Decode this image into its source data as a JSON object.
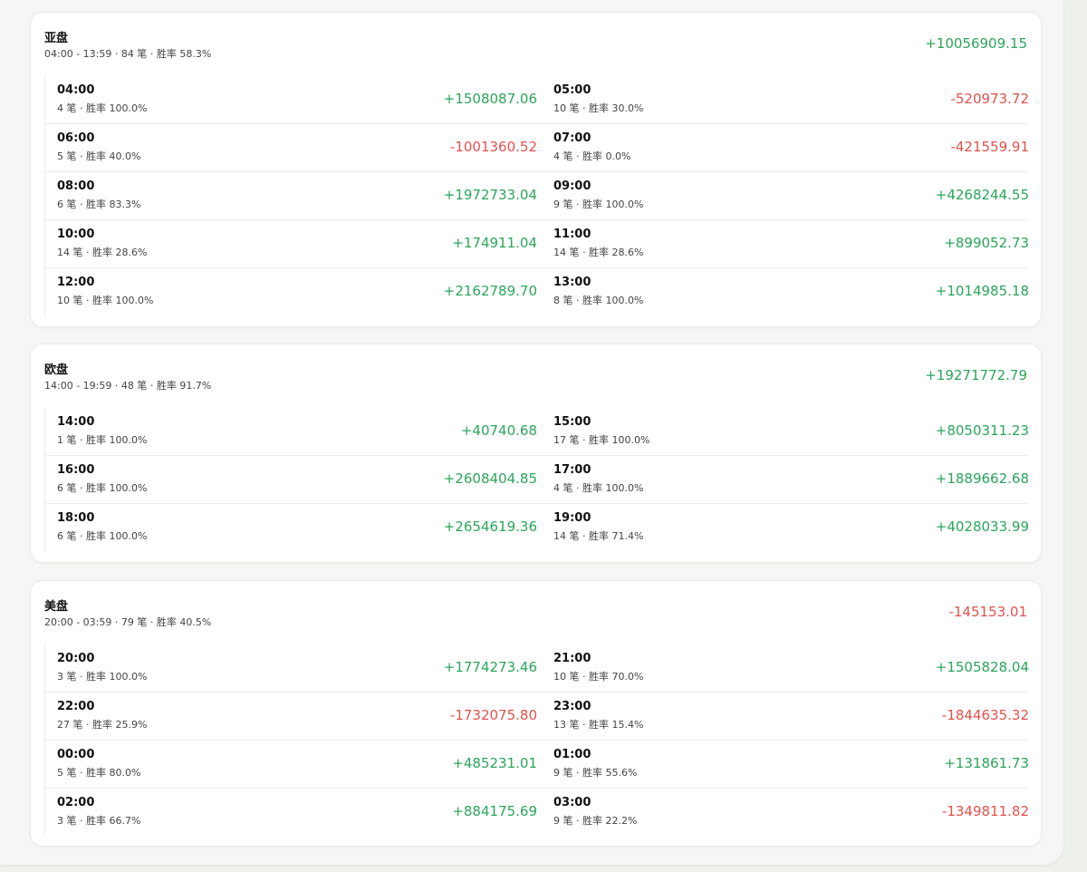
{
  "sessions": [
    {
      "name": "亚盘",
      "summary": "04:00 - 13:59 · 84 笔 · 胜率 58.3%",
      "total": "+10056909.15",
      "total_sign": "pos",
      "hours": [
        {
          "hour": "04:00",
          "stats": "4 笔 · 胜率 100.0%",
          "pnl": "+1508087.06",
          "sign": "pos"
        },
        {
          "hour": "05:00",
          "stats": "10 笔 · 胜率 30.0%",
          "pnl": "-520973.72",
          "sign": "neg"
        },
        {
          "hour": "06:00",
          "stats": "5 笔 · 胜率 40.0%",
          "pnl": "-1001360.52",
          "sign": "neg"
        },
        {
          "hour": "07:00",
          "stats": "4 笔 · 胜率 0.0%",
          "pnl": "-421559.91",
          "sign": "neg"
        },
        {
          "hour": "08:00",
          "stats": "6 笔 · 胜率 83.3%",
          "pnl": "+1972733.04",
          "sign": "pos"
        },
        {
          "hour": "09:00",
          "stats": "9 笔 · 胜率 100.0%",
          "pnl": "+4268244.55",
          "sign": "pos"
        },
        {
          "hour": "10:00",
          "stats": "14 笔 · 胜率 28.6%",
          "pnl": "+174911.04",
          "sign": "pos"
        },
        {
          "hour": "11:00",
          "stats": "14 笔 · 胜率 28.6%",
          "pnl": "+899052.73",
          "sign": "pos"
        },
        {
          "hour": "12:00",
          "stats": "10 笔 · 胜率 100.0%",
          "pnl": "+2162789.70",
          "sign": "pos"
        },
        {
          "hour": "13:00",
          "stats": "8 笔 · 胜率 100.0%",
          "pnl": "+1014985.18",
          "sign": "pos"
        }
      ]
    },
    {
      "name": "欧盘",
      "summary": "14:00 - 19:59 · 48 笔 · 胜率 91.7%",
      "total": "+19271772.79",
      "total_sign": "pos",
      "hours": [
        {
          "hour": "14:00",
          "stats": "1 笔 · 胜率 100.0%",
          "pnl": "+40740.68",
          "sign": "pos"
        },
        {
          "hour": "15:00",
          "stats": "17 笔 · 胜率 100.0%",
          "pnl": "+8050311.23",
          "sign": "pos"
        },
        {
          "hour": "16:00",
          "stats": "6 笔 · 胜率 100.0%",
          "pnl": "+2608404.85",
          "sign": "pos"
        },
        {
          "hour": "17:00",
          "stats": "4 笔 · 胜率 100.0%",
          "pnl": "+1889662.68",
          "sign": "pos"
        },
        {
          "hour": "18:00",
          "stats": "6 笔 · 胜率 100.0%",
          "pnl": "+2654619.36",
          "sign": "pos"
        },
        {
          "hour": "19:00",
          "stats": "14 笔 · 胜率 71.4%",
          "pnl": "+4028033.99",
          "sign": "pos"
        }
      ]
    },
    {
      "name": "美盘",
      "summary": "20:00 - 03:59 · 79 笔 · 胜率 40.5%",
      "total": "-145153.01",
      "total_sign": "neg",
      "hours": [
        {
          "hour": "20:00",
          "stats": "3 笔 · 胜率 100.0%",
          "pnl": "+1774273.46",
          "sign": "pos"
        },
        {
          "hour": "21:00",
          "stats": "10 笔 · 胜率 70.0%",
          "pnl": "+1505828.04",
          "sign": "pos"
        },
        {
          "hour": "22:00",
          "stats": "27 笔 · 胜率 25.9%",
          "pnl": "-1732075.80",
          "sign": "neg"
        },
        {
          "hour": "23:00",
          "stats": "13 笔 · 胜率 15.4%",
          "pnl": "-1844635.32",
          "sign": "neg"
        },
        {
          "hour": "00:00",
          "stats": "5 笔 · 胜率 80.0%",
          "pnl": "+485231.01",
          "sign": "pos"
        },
        {
          "hour": "01:00",
          "stats": "9 笔 · 胜率 55.6%",
          "pnl": "+131861.73",
          "sign": "pos"
        },
        {
          "hour": "02:00",
          "stats": "3 笔 · 胜率 66.7%",
          "pnl": "+884175.69",
          "sign": "pos"
        },
        {
          "hour": "03:00",
          "stats": "9 笔 · 胜率 22.2%",
          "pnl": "-1349811.82",
          "sign": "neg"
        }
      ]
    }
  ],
  "colors": {
    "positive": "#2aa55a",
    "negative": "#e2514c"
  }
}
